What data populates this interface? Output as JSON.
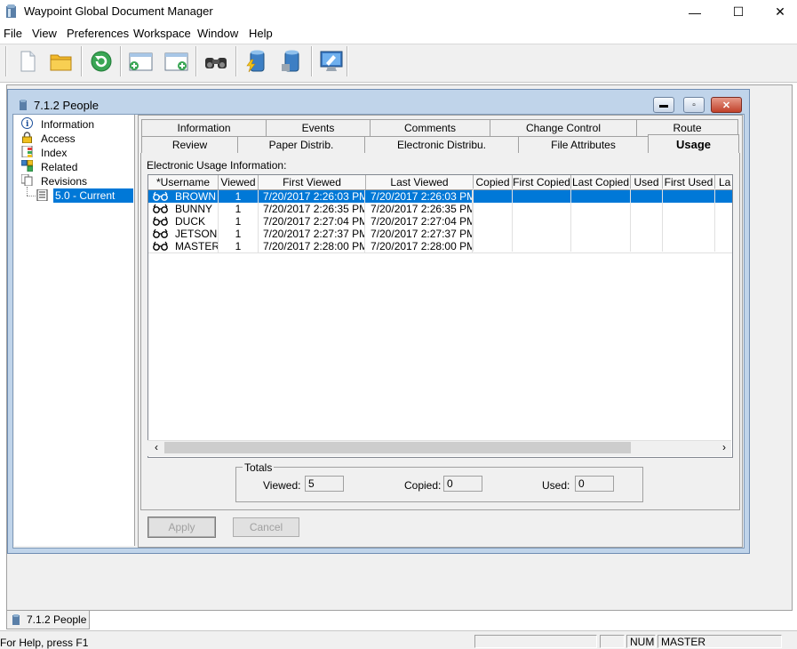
{
  "app": {
    "title": "Waypoint Global Document Manager",
    "window_controls": {
      "minimize": "—",
      "maximize": "☐",
      "close": "✕"
    }
  },
  "menu": [
    "File",
    "View",
    "Preferences",
    "Workspace",
    "Window",
    "Help"
  ],
  "toolbar": {
    "buttons": [
      "new-document-icon",
      "open-folder-icon",
      "refresh-icon",
      "add-window-icon",
      "add-document-icon",
      "binoculars-icon",
      "lightning-database-icon",
      "database-icon",
      "monitor-icon"
    ]
  },
  "child_window": {
    "title": "7.1.2 People",
    "controls": {
      "minimize": "▬",
      "restore": "▫",
      "close": "✕"
    }
  },
  "tree": {
    "items": [
      "Information",
      "Access",
      "Index",
      "Related",
      "Revisions"
    ],
    "revision": "5.0    - Current"
  },
  "tabs": {
    "row1": [
      "Information",
      "Events",
      "Comments",
      "Change Control",
      "Route"
    ],
    "row2": [
      "Review",
      "Paper Distrib.",
      "Electronic Distribu.",
      "File Attributes",
      "Usage"
    ],
    "active": "Usage"
  },
  "usage": {
    "section_label": "Electronic Usage Information:",
    "columns": [
      "*Username",
      "Viewed",
      "First Viewed",
      "Last Viewed",
      "Copied",
      "First Copied",
      "Last Copied",
      "Used",
      "First Used",
      "La"
    ],
    "rows": [
      {
        "username": "BROWN",
        "viewed": "1",
        "first_viewed": "7/20/2017  2:26:03 PM",
        "last_viewed": "7/20/2017  2:26:03 PM",
        "selected": true
      },
      {
        "username": "BUNNY",
        "viewed": "1",
        "first_viewed": "7/20/2017  2:26:35 PM",
        "last_viewed": "7/20/2017  2:26:35 PM",
        "selected": false
      },
      {
        "username": "DUCK",
        "viewed": "1",
        "first_viewed": "7/20/2017  2:27:04 PM",
        "last_viewed": "7/20/2017  2:27:04 PM",
        "selected": false
      },
      {
        "username": "JETSON",
        "viewed": "1",
        "first_viewed": "7/20/2017  2:27:37 PM",
        "last_viewed": "7/20/2017  2:27:37 PM",
        "selected": false
      },
      {
        "username": "MASTER",
        "viewed": "1",
        "first_viewed": "7/20/2017  2:28:00 PM",
        "last_viewed": "7/20/2017  2:28:00 PM",
        "selected": false
      }
    ],
    "scroll_left": "‹",
    "scroll_right": "›"
  },
  "totals": {
    "legend": "Totals",
    "viewed_label": "Viewed:",
    "viewed_value": "5",
    "copied_label": "Copied:",
    "copied_value": "0",
    "used_label": "Used:",
    "used_value": "0"
  },
  "buttons": {
    "apply": "Apply",
    "cancel": "Cancel"
  },
  "mdi_tab": "7.1.2 People",
  "status": {
    "help_text": "For Help, press F1",
    "num": "NUM",
    "user": "MASTER"
  }
}
